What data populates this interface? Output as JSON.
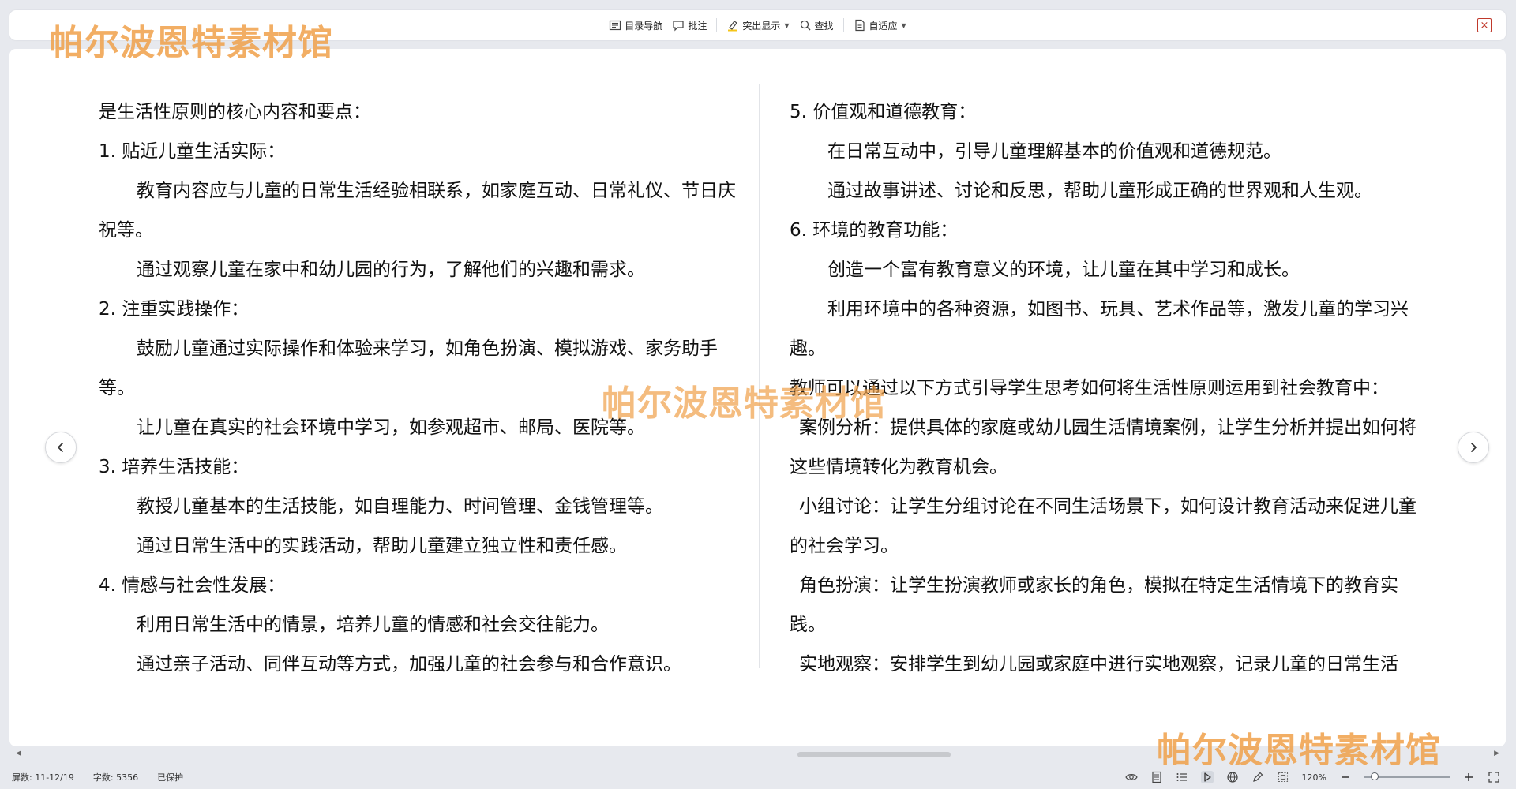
{
  "toolbar": {
    "toc_label": "目录导航",
    "comment_label": "批注",
    "highlight_label": "突出显示",
    "find_label": "查找",
    "fit_label": "自适应",
    "close_symbol": "×"
  },
  "left_page": {
    "intro": "是生活性原则的核心内容和要点：",
    "sections": [
      {
        "heading": "1.  贴近儿童生活实际：",
        "points": [
          "教育内容应与儿童的日常生活经验相联系，如家庭互动、日常礼仪、节日庆祝等。",
          "通过观察儿童在家中和幼儿园的行为，了解他们的兴趣和需求。"
        ]
      },
      {
        "heading": "2.  注重实践操作：",
        "points": [
          "鼓励儿童通过实际操作和体验来学习，如角色扮演、模拟游戏、家务助手等。",
          "让儿童在真实的社会环境中学习，如参观超市、邮局、医院等。"
        ]
      },
      {
        "heading": "3.  培养生活技能：",
        "points": [
          "教授儿童基本的生活技能，如自理能力、时间管理、金钱管理等。",
          "通过日常生活中的实践活动，帮助儿童建立独立性和责任感。"
        ]
      },
      {
        "heading": "4.  情感与社会性发展：",
        "points": [
          "利用日常生活中的情景，培养儿童的情感和社会交往能力。",
          "通过亲子活动、同伴互动等方式，加强儿童的社会参与和合作意识。"
        ]
      }
    ]
  },
  "right_page": {
    "sections": [
      {
        "heading": "5.  价值观和道德教育：",
        "points": [
          "在日常互动中，引导儿童理解基本的价值观和道德规范。",
          "通过故事讲述、讨论和反思，帮助儿童形成正确的世界观和人生观。"
        ]
      },
      {
        "heading": "6.  环境的教育功能：",
        "points": [
          "创造一个富有教育意义的环境，让儿童在其中学习和成长。",
          "利用环境中的各种资源，如图书、玩具、艺术作品等，激发儿童的学习兴趣。"
        ]
      }
    ],
    "guide_intro": "教师可以通过以下方式引导学生思考如何将生活性原则运用到社会教育中：",
    "methods": [
      "案例分析：提供具体的家庭或幼儿园生活情境案例，让学生分析并提出如何将这些情境转化为教育机会。",
      "小组讨论：让学生分组讨论在不同生活场景下，如何设计教育活动来促进儿童的社会学习。",
      "角色扮演：让学生扮演教师或家长的角色，模拟在特定生活情境下的教育实践。",
      "实地观察：安排学生到幼儿园或家庭中进行实地观察，记录儿童的日常生活"
    ]
  },
  "watermark": {
    "text": "帕尔波恩特素材馆"
  },
  "statusbar": {
    "page_info": "屏数: 11-12/19",
    "word_count": "字数: 5356",
    "protection": "已保护",
    "zoom": "120%",
    "zoom_fraction": 0.12
  },
  "colors": {
    "watermark": "#f0a14a",
    "close": "#c0392b",
    "background": "#e7e9ee"
  }
}
